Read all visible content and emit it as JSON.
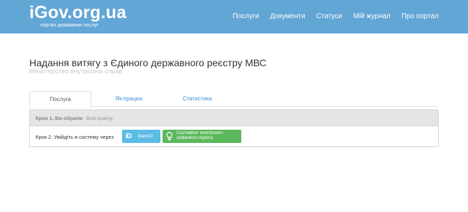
{
  "header": {
    "logo": "iGov.org.ua",
    "tagline": "портал державних послуг",
    "nav": [
      "Послуги",
      "Документи",
      "Статуси",
      "Мій журнал",
      "Про портал"
    ]
  },
  "service": {
    "title": "Надання витягу з Єдиного державного реєстру МВС",
    "ministry": "Міністерство внутрішніх справ"
  },
  "tabs": [
    "Послуга",
    "Як працює",
    "Статистика"
  ],
  "steps": {
    "step1_label": "Крок 1. Ви обрали",
    "step1_value": "Всю країну.",
    "step2_label": "Крок 2. Увійдіть в систему через"
  },
  "auth": {
    "bankid_label": "BankID",
    "bankid_icon": "bankid-icon",
    "cert_label_line1": "Сертифікат електронно-",
    "cert_label_line2": "цифрового підпису",
    "cert_icon": "lightbulb-icon"
  },
  "colors": {
    "header_bg": "#62a6d6",
    "link": "#3a8ed6",
    "bankid_bg": "#5bbce6",
    "cert_bg": "#5cb85c"
  }
}
